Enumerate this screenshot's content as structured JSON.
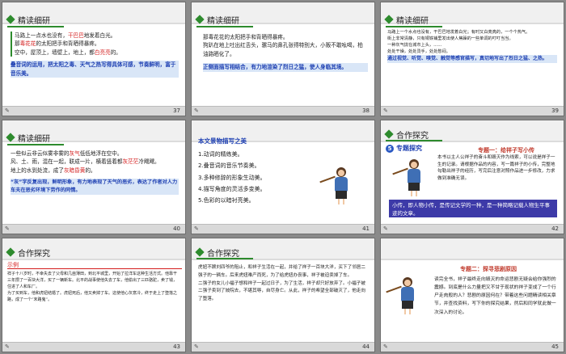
{
  "slides": [
    {
      "number": "37",
      "header": "精读细研",
      "lines": [
        {
          "pre": "马路上一点水也没有，",
          "red": "干巴巴",
          "post": "地发着白光。"
        },
        {
          "pre": "那",
          "red": "毒花花",
          "post": "的太阳把手和背晒得暴疼。"
        },
        {
          "pre": "空中，屋顶上，墙壁上，地上，都",
          "red": "白亮亮",
          "post": "的。"
        }
      ],
      "note": "叠音词的运用，把太阳之毒、天气之热写得具体可感，节奏鲜明，富于音乐美。"
    },
    {
      "number": "38",
      "header": "精读细研",
      "lines": [
        "那毒花花的太阳把手和背晒得暴疼。",
        "狗趴在地上吐出红舌头，骡马的鼻孔张得特别大，小贩不敢吆喝，柏油路晒化了。"
      ],
      "note": "正侧面描写相结合，有力地渲染了烈日之猛，使人身临其境。"
    },
    {
      "number": "39",
      "header": "精读细研",
      "lines": [
        "马路上一个水点也没有，干巴巴地发着白光；有时又白亮亮的，一个个热气。",
        "街上非常清静，只有铜铁铺里发出使人焦躁的一些单调的叮叮当当。",
        "一种灰气拢在城市上头，……",
        "处处干燥，处处烫手，处处憋闷。"
      ],
      "note": "通过视觉、听觉、嗅觉、触觉等感官描写，真切地写出了烈日之猛、之热。"
    },
    {
      "number": "40",
      "header": "精读细研",
      "lines": [
        {
          "pre": "一些似云非云似雾非雾的",
          "red": "灰气",
          "post": "低低地浮在空中。"
        },
        {
          "pre": "风、土、雨，混在一起，联成一片，横着竖着都",
          "red": "灰茫茫",
          "post": "冷飕飕。"
        },
        {
          "pre": "地上的水到处流，成了",
          "red": "灰暗昏黄",
          "post": "的。"
        }
      ],
      "note": "“灰”字反复出现，鲜明形象，有力地表现了天气的恶劣，表达了作者对人力车夫在恶劣环境下劳作的同情。"
    },
    {
      "number": "41",
      "title": "本文景物描写之美",
      "items": [
        "1.动词的精练美。",
        "2.叠音词的音乐节奏美。",
        "3.多种修辞的形象生动美。",
        "4.描写角度的灵活多变美。",
        "5.色彩的以暗衬亮美。"
      ]
    },
    {
      "number": "42",
      "header": "合作探究",
      "sub_badge": "5",
      "sub_title": "专题探究",
      "topic": "专题一：给祥子写小传",
      "body": "本书以主人公祥子的奋斗和毁灭作为线索，可以说是祥子一生的记录。请根据作品的内容，写一篇祥子的小传，完整地勾勒出祥子的经历，写完后注意对照作品进一步修改，力求做到准确无误。",
      "note": "小传，即人物小传，是传记文学的一种，是一种简略记载人物生平事迹的文章。"
    },
    {
      "number": "43",
      "header": "合作探究",
      "example_label": "示例",
      "body": "祥子十八岁时，不幸失去了父母和几亩薄田，到北平城里，开始了拉洋车这种生活方式。他靠干三年攒了一百块大洋，买了一辆新车。北平的战事使他失去了车，他偷出了三匹骆驼，卖了钱，住进了人和车厂。",
      "body2": "为了买到车，他和虎妞结婚了。虎妞死后，他又卖掉了车。这使他心灰意冷，终于走上了堕落之路，成了一个“末路鬼”。"
    },
    {
      "number": "44",
      "header": "合作探究",
      "body": "虎妞不顾刘四爷的阻止，和祥子生活在一起，并给了祥子一百块大洋，买下了邻居二强子的一辆车。后来虎妞难产而死，为了给虎妞办丧事，祥子被迫卖掉了车。",
      "body2": "二强子的女儿小福子想和祥子一起过日子，为了生活，祥子却只好放弃了。小福子被二强子卖到了妓院去，不堪其辱，自尽身亡。从此，祥子的希望全部破灭了，他走向了堕落。"
    },
    {
      "number": "45",
      "topic": "专题二：探寻悲剧原因",
      "body": "读完全书，祥子最终走向毁灭的命运悲剧无疑会给你强烈的震撼。到底是什么力量把又不甘于现状的祥子变成了一个行尸走肉般的人？悲剧的原因何在？带着这些问题精读相关章节，并查找资料，写下你的探究结果，然后和同学就此做一次深入的讨论。"
    }
  ]
}
